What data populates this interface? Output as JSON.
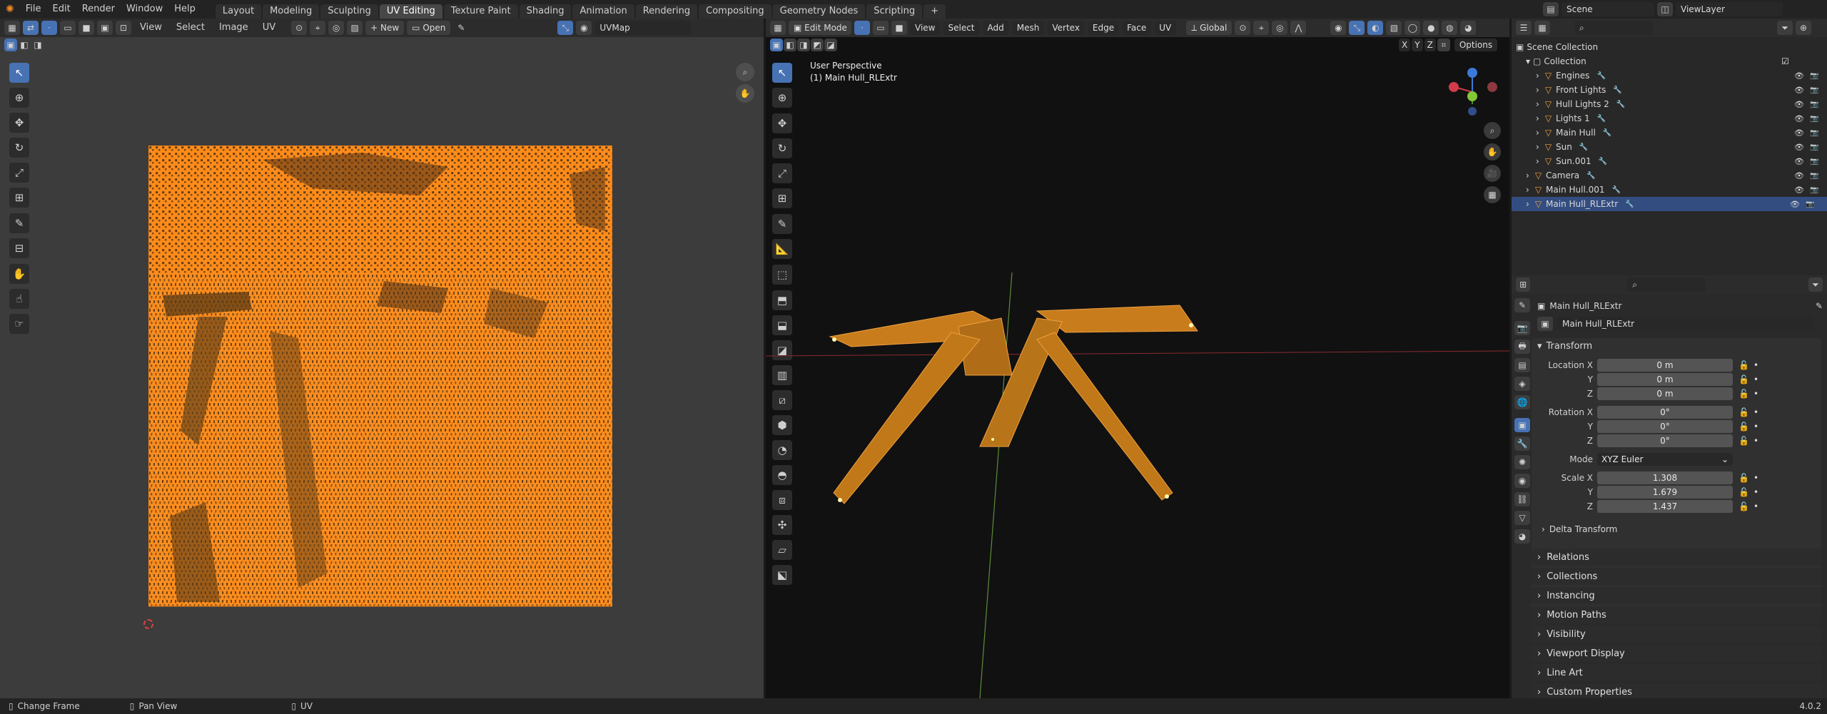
{
  "topbar": {
    "menus": [
      "File",
      "Edit",
      "Render",
      "Window",
      "Help"
    ],
    "workspaces": [
      "Layout",
      "Modeling",
      "Sculpting",
      "UV Editing",
      "Texture Paint",
      "Shading",
      "Animation",
      "Rendering",
      "Compositing",
      "Geometry Nodes",
      "Scripting"
    ],
    "active_workspace": "UV Editing",
    "add_tab": "+",
    "scene": "Scene",
    "view_layer": "ViewLayer"
  },
  "uv_editor": {
    "menus": [
      "View",
      "Select",
      "Image",
      "UV"
    ],
    "new_label": "New",
    "open_label": "Open",
    "uvmap": "UVMap"
  },
  "viewport": {
    "mode": "Edit Mode",
    "menus": [
      "View",
      "Select",
      "Add",
      "Mesh",
      "Vertex",
      "Edge",
      "Face",
      "UV"
    ],
    "transform_orientation": "Global",
    "overlay_title": "User Perspective",
    "overlay_object": "(1) Main Hull_RLExtr",
    "axis_x": "X",
    "axis_y": "Y",
    "axis_z": "Z",
    "options": "Options"
  },
  "outliner": {
    "root": "Scene Collection",
    "collection": "Collection",
    "items": [
      {
        "name": "Engines",
        "indent": 2
      },
      {
        "name": "Front Lights",
        "indent": 2
      },
      {
        "name": "Hull Lights 2",
        "indent": 2
      },
      {
        "name": "Lights 1",
        "indent": 2
      },
      {
        "name": "Main Hull",
        "indent": 2
      },
      {
        "name": "Sun",
        "indent": 2
      },
      {
        "name": "Sun.001",
        "indent": 2
      },
      {
        "name": "Camera",
        "indent": 1
      },
      {
        "name": "Main Hull.001",
        "indent": 1
      },
      {
        "name": "Main Hull_RLExtr",
        "indent": 1,
        "selected": true
      }
    ]
  },
  "properties": {
    "object_name": "Main Hull_RLExtr",
    "object_field": "Main Hull_RLExtr",
    "transform_title": "Transform",
    "location": {
      "label_x": "Location X",
      "label_y": "Y",
      "label_z": "Z",
      "x": "0 m",
      "y": "0 m",
      "z": "0 m"
    },
    "rotation": {
      "label_x": "Rotation X",
      "label_y": "Y",
      "label_z": "Z",
      "x": "0°",
      "y": "0°",
      "z": "0°"
    },
    "mode_label": "Mode",
    "mode_value": "XYZ Euler",
    "scale": {
      "label_x": "Scale X",
      "label_y": "Y",
      "label_z": "Z",
      "x": "1.308",
      "y": "1.679",
      "z": "1.437"
    },
    "delta_transform": "Delta Transform",
    "panels": [
      "Relations",
      "Collections",
      "Instancing",
      "Motion Paths",
      "Visibility",
      "Viewport Display",
      "Line Art",
      "Custom Properties"
    ]
  },
  "statusbar": {
    "left": "Change Frame",
    "middle": "Pan View",
    "right": "UV",
    "version": "4.0.2"
  },
  "colors": {
    "accent": "#4772b3",
    "uv_orange": "#ff8b1a",
    "mesh_orange": "#e8901c"
  }
}
